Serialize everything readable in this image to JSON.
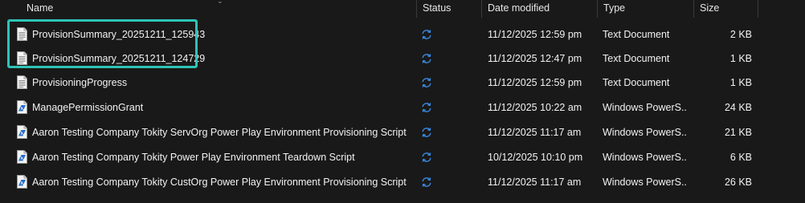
{
  "columns": {
    "name": "Name",
    "status": "Status",
    "date_modified": "Date modified",
    "type": "Type",
    "size": "Size"
  },
  "colors": {
    "background": "#191919",
    "highlight_border": "#2ec4b6",
    "sync_icon": "#3b8eea"
  },
  "files": [
    {
      "name": "ProvisionSummary_20251211_125943",
      "icon": "text-document-icon",
      "status_icon": "sync-icon",
      "date": "11/12/2025 12:59 pm",
      "type": "Text Document",
      "size": "2 KB"
    },
    {
      "name": "ProvisionSummary_20251211_124729",
      "icon": "text-document-icon",
      "status_icon": "sync-icon",
      "date": "11/12/2025 12:47 pm",
      "type": "Text Document",
      "size": "1 KB"
    },
    {
      "name": "ProvisioningProgress",
      "icon": "text-document-icon",
      "status_icon": "sync-icon",
      "date": "11/12/2025 12:59 pm",
      "type": "Text Document",
      "size": "1 KB"
    },
    {
      "name": "ManagePermissionGrant",
      "icon": "powershell-script-icon",
      "status_icon": "sync-icon",
      "date": "11/12/2025 10:22 am",
      "type": "Windows PowerS...",
      "size": "24 KB"
    },
    {
      "name": "Aaron Testing Company Tokity ServOrg Power Play Environment Provisioning Script",
      "icon": "powershell-script-icon",
      "status_icon": "sync-icon",
      "date": "11/12/2025 11:17 am",
      "type": "Windows PowerS...",
      "size": "21 KB"
    },
    {
      "name": "Aaron Testing Company Tokity Power Play Environment Teardown Script",
      "icon": "powershell-script-icon",
      "status_icon": "sync-icon",
      "date": "10/12/2025 10:10 pm",
      "type": "Windows PowerS...",
      "size": "6 KB"
    },
    {
      "name": "Aaron Testing Company Tokity CustOrg Power Play Environment Provisioning Script",
      "icon": "powershell-script-icon",
      "status_icon": "sync-icon",
      "date": "11/12/2025 11:17 am",
      "type": "Windows PowerS...",
      "size": "26 KB"
    }
  ]
}
